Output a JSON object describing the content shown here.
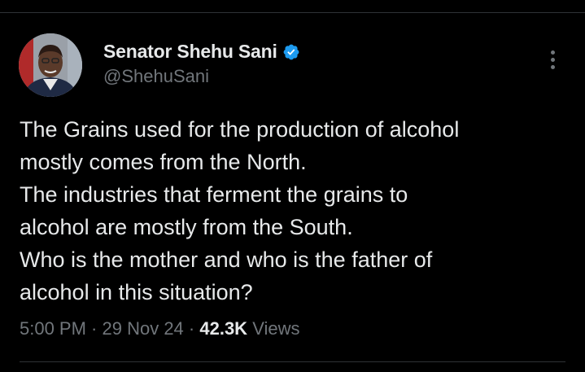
{
  "author": {
    "display_name": "Senator Shehu Sani",
    "handle": "@ShehuSani",
    "verified_icon": "verified-badge-icon",
    "verified_color": "#1d9bf0"
  },
  "tweet": {
    "text": "The Grains used for the production of alcohol\nmostly comes from the North.\nThe industries that ferment the grains to\nalcohol are mostly from the South.\nWho is the mother and who is the father of\nalcohol in this situation?"
  },
  "meta": {
    "time": "5:00 PM",
    "separator_1": " · ",
    "date": "29 Nov 24",
    "separator_2": " · ",
    "views_count": "42.3K",
    "views_label": " Views"
  },
  "menu": {
    "icon": "more-options-icon"
  },
  "colors": {
    "background": "#000000",
    "primary_text": "#e7e9ea",
    "secondary_text": "#71767b",
    "divider": "#2f3336"
  }
}
